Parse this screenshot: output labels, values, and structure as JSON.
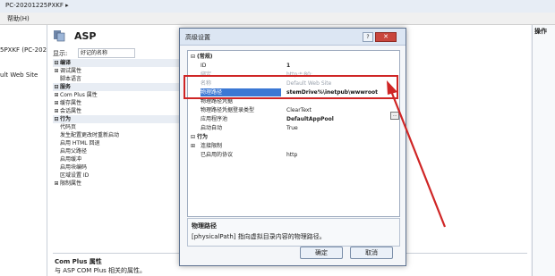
{
  "window": {
    "breadcrumb": "PC-20201225PXKF  ▸",
    "menu_help": "帮助(H)"
  },
  "tree": {
    "server": "5PXKF (PC-202",
    "site": "ult Web Site"
  },
  "center": {
    "title": "ASP",
    "show_label": "显示:",
    "show_value": "好记的名称",
    "rows": [
      {
        "pre": "⊟",
        "text": "编译",
        "cat": true
      },
      {
        "pre": "⊞",
        "text": "调试属性",
        "cat": false
      },
      {
        "pre": "",
        "text": "脚本语言",
        "cat": false
      },
      {
        "pre": "⊟",
        "text": "服务",
        "cat": true
      },
      {
        "pre": "⊞",
        "text": "Com Plus 属性",
        "cat": false
      },
      {
        "pre": "⊞",
        "text": "缓存属性",
        "cat": false
      },
      {
        "pre": "⊞",
        "text": "会话属性",
        "cat": false
      },
      {
        "pre": "⊟",
        "text": "行为",
        "cat": true
      },
      {
        "pre": "",
        "text": "代码页",
        "cat": false
      },
      {
        "pre": "",
        "text": "发生配置更改时重新启动",
        "cat": false
      },
      {
        "pre": "",
        "text": "启用 HTML 回退",
        "cat": false
      },
      {
        "pre": "",
        "text": "启用父路径",
        "cat": false
      },
      {
        "pre": "",
        "text": "启用缓冲",
        "cat": false
      },
      {
        "pre": "",
        "text": "启用块编码",
        "cat": false
      },
      {
        "pre": "",
        "text": "区域设置 ID",
        "cat": false
      },
      {
        "pre": "⊞",
        "text": "限制属性",
        "cat": false
      }
    ],
    "desc_title": "Com Plus 属性",
    "desc_text": "与 ASP COM Plus 相关的属性。"
  },
  "actions": {
    "header": "操作"
  },
  "dialog": {
    "title": "高级设置",
    "help": "?",
    "close": "✕",
    "rows": [
      {
        "ex": "⊟",
        "k": "(常规)",
        "v": "",
        "type": "cat"
      },
      {
        "ex": "",
        "k": "ID",
        "v": "1",
        "type": "normal",
        "bold": true
      },
      {
        "ex": "",
        "k": "绑定",
        "v": "http:*:80:",
        "type": "gray"
      },
      {
        "ex": "",
        "k": "名称",
        "v": "Default Web Site",
        "type": "gray"
      },
      {
        "ex": "",
        "k": "物理路径",
        "v": "stemDrive%\\inetpub\\wwwroot",
        "type": "sel"
      },
      {
        "ex": "",
        "k": "物理路径凭据",
        "v": "",
        "type": "normal"
      },
      {
        "ex": "",
        "k": "物理路径凭据登录类型",
        "v": "ClearText",
        "type": "normal"
      },
      {
        "ex": "",
        "k": "应用程序池",
        "v": "DefaultAppPool",
        "type": "normal",
        "bold": true
      },
      {
        "ex": "",
        "k": "启动自动",
        "v": "True",
        "type": "normal"
      },
      {
        "ex": "⊟",
        "k": "行为",
        "v": "",
        "type": "cat"
      },
      {
        "ex": "⊞",
        "k": "连接限制",
        "v": "",
        "type": "normal"
      },
      {
        "ex": "",
        "k": "已启用的协议",
        "v": "http",
        "type": "normal"
      }
    ],
    "browse": "...",
    "desc_title": "物理路径",
    "desc_text": "[physicalPath] 指向虚拟目录内容的物理路径。",
    "ok": "确定",
    "cancel": "取消"
  },
  "colors": {
    "highlight_box": "#cf2525",
    "selection": "#3b78d4"
  }
}
